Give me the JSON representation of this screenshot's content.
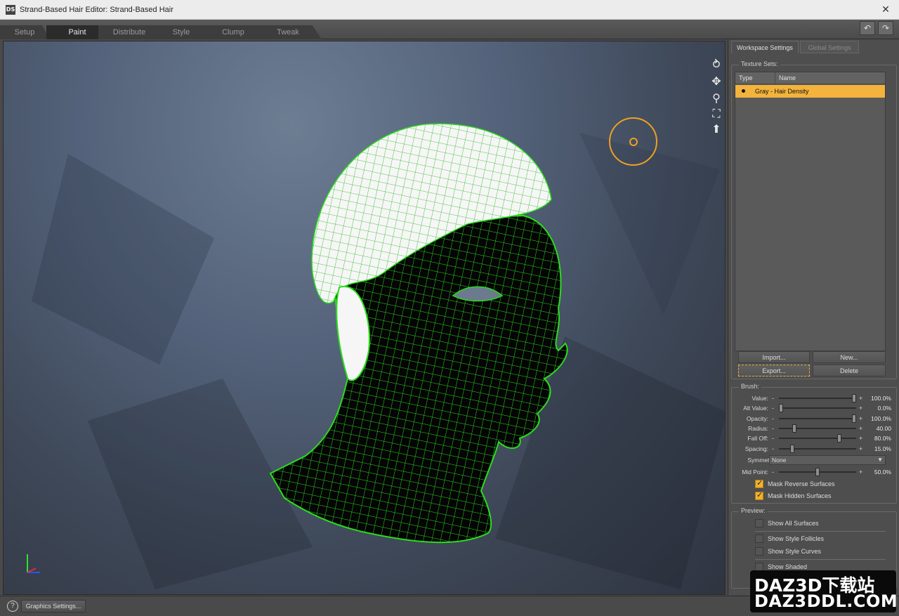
{
  "window": {
    "title": "Strand-Based Hair Editor: Strand-Based Hair",
    "app_icon": "DS",
    "close": "✕"
  },
  "tabs": [
    {
      "label": "Setup",
      "active": false
    },
    {
      "label": "Paint",
      "active": true
    },
    {
      "label": "Distribute",
      "active": false
    },
    {
      "label": "Style",
      "active": false
    },
    {
      "label": "Clump",
      "active": false
    },
    {
      "label": "Tweak",
      "active": false
    }
  ],
  "toolbar": {
    "undo_icon": "↶",
    "redo_icon": "↷"
  },
  "viewport_tools": [
    {
      "icon": "orbit-icon",
      "glyph": "⥁"
    },
    {
      "icon": "pan-icon",
      "glyph": "✥"
    },
    {
      "icon": "zoom-icon",
      "glyph": "⚲"
    },
    {
      "icon": "frame-icon",
      "glyph": "⛶"
    },
    {
      "icon": "home-icon",
      "glyph": "⬆"
    }
  ],
  "panel": {
    "tabs": [
      "Workspace Settings",
      "Global Settings"
    ],
    "texture_sets": {
      "label": "Texture Sets:",
      "columns": [
        "Type",
        "Name"
      ],
      "rows": [
        {
          "name": "Gray - Hair Density",
          "selected": true
        }
      ],
      "buttons": {
        "import": "Import...",
        "new": "New...",
        "export": "Export...",
        "delete": "Delete"
      }
    },
    "brush": {
      "label": "Brush:",
      "sliders": [
        {
          "label": "Value:",
          "value": "100.0%",
          "level": 1.0
        },
        {
          "label": "Alt Value:",
          "value": "0.0%",
          "level": 0.0
        },
        {
          "label": "Opacity:",
          "value": "100.0%",
          "level": 1.0
        },
        {
          "label": "Radius:",
          "value": "40.00",
          "level": 0.18
        },
        {
          "label": "Fall Off:",
          "value": "80.0%",
          "level": 0.8
        },
        {
          "label": "Spacing:",
          "value": "15.0%",
          "level": 0.15
        }
      ],
      "symmetry": {
        "label": "Symmetry:",
        "value": "None"
      },
      "mid_point": {
        "label": "Mid Point:",
        "value": "50.0%",
        "level": 0.5
      },
      "checkboxes": [
        {
          "label": "Mask Reverse Surfaces",
          "checked": true
        },
        {
          "label": "Mask Hidden Surfaces",
          "checked": true
        }
      ]
    },
    "preview": {
      "label": "Preview:",
      "checkboxes": [
        {
          "label": "Show All Surfaces",
          "checked": false
        },
        {
          "label": "Show Style Follicles",
          "checked": false
        },
        {
          "label": "Show Style Curves",
          "checked": false
        },
        {
          "label": "Show Shaded",
          "checked": false
        }
      ]
    }
  },
  "bottom": {
    "help": "?",
    "graphics_settings": "Graphics Settings..."
  },
  "watermark": {
    "line1": "DAZ3D下载站",
    "line2": "DAZ3DDL.COM"
  },
  "colors": {
    "accent": "#f3b33c",
    "wire": "#2bdc1e",
    "brush": "#f0a020"
  }
}
